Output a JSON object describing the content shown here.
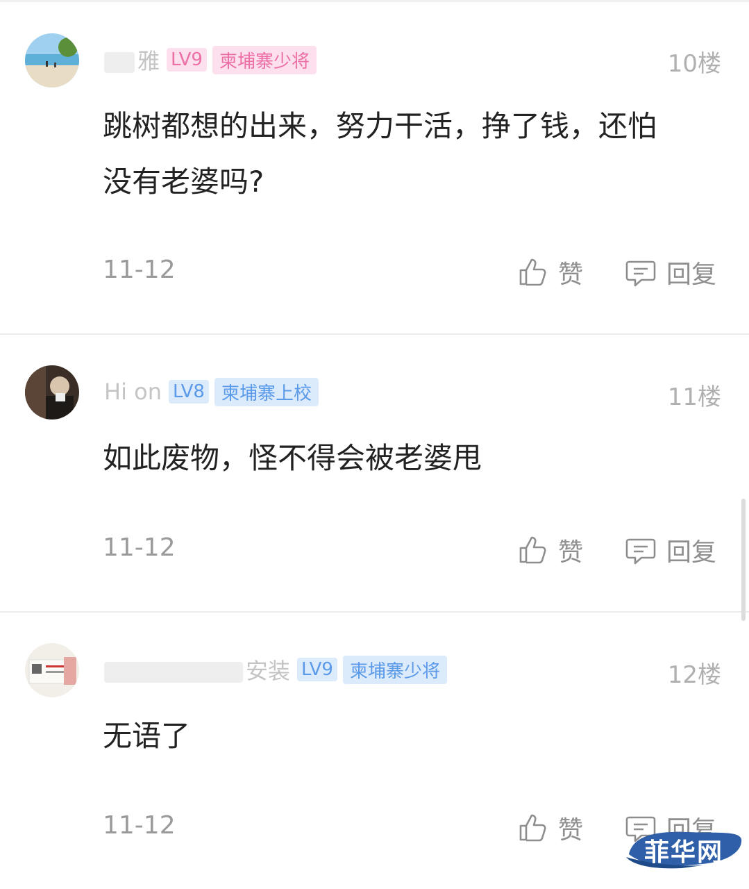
{
  "comments": [
    {
      "user_name": "雅",
      "level": "LV9",
      "rank_badge": "柬埔寨少将",
      "floor": "10楼",
      "content": "跳树都想的出来，努力干活，挣了钱，还怕没有老婆吗?",
      "date": "11-12",
      "like_label": "赞",
      "reply_label": "回复"
    },
    {
      "user_name": "Hi on",
      "level": "LV8",
      "rank_badge": "柬埔寨上校",
      "floor": "11楼",
      "content": "如此废物，怪不得会被老婆甩",
      "date": "11-12",
      "like_label": "赞",
      "reply_label": "回复"
    },
    {
      "user_name": "安装",
      "level": "LV9",
      "rank_badge": "柬埔寨少将",
      "floor": "12楼",
      "content": "无语了",
      "date": "11-12",
      "like_label": "赞",
      "reply_label": "回复"
    }
  ],
  "watermark": "菲华网",
  "icons": [
    "thumbs-up-icon",
    "comment-bubble-icon"
  ],
  "colors": {
    "pink_badge": "#ec6fa6",
    "blue_badge": "#5b9ae8",
    "watermark_bg": "#2f5fa8"
  }
}
